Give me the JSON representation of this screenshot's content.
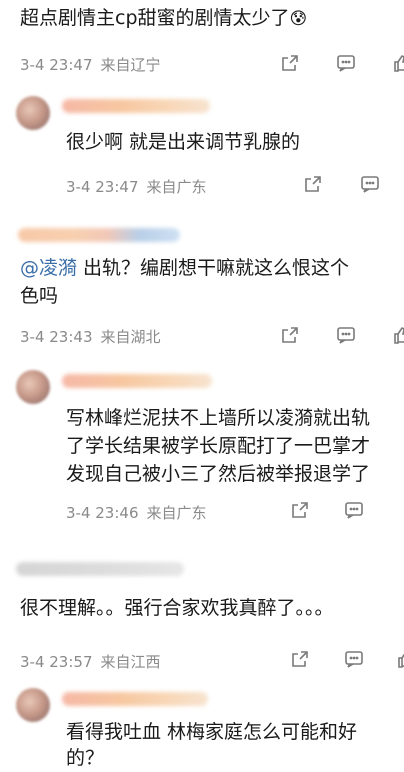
{
  "comments": [
    {
      "text": "超点剧情主cp甜蜜的剧情太少了",
      "emoji": "😰",
      "time": "3-4 23:47",
      "location": "来自辽宁"
    },
    {
      "text": "很少啊 就是出来调节乳腺的",
      "time": "3-4 23:47",
      "location": "来自广东"
    },
    {
      "mention": "@凌漪",
      "text_line1": " 出轨？编剧想干嘛就这么恨这个",
      "text_line2": "色吗",
      "time": "3-4 23:43",
      "location": "来自湖北"
    },
    {
      "lines": [
        "写林峰烂泥扶不上墙所以凌漪就出轨",
        "了学长结果被学长原配打了一巴掌才",
        "发现自己被小三了然后被举报退学了"
      ],
      "time": "3-4 23:46",
      "location": "来自广东"
    },
    {
      "text": "很不理解。。强行合家欢我真醉了。。。",
      "time": "3-4 23:57",
      "location": "来自江西"
    },
    {
      "lines": [
        "看得我吐血 林梅家庭怎么可能和好",
        "的？"
      ]
    }
  ],
  "icons": {
    "share": "share-icon",
    "comment": "comment-icon",
    "like": "like-icon"
  },
  "colors": {
    "mention": "#3a6ea8",
    "meta": "#8a8a8a",
    "text": "#1a1a1a"
  }
}
